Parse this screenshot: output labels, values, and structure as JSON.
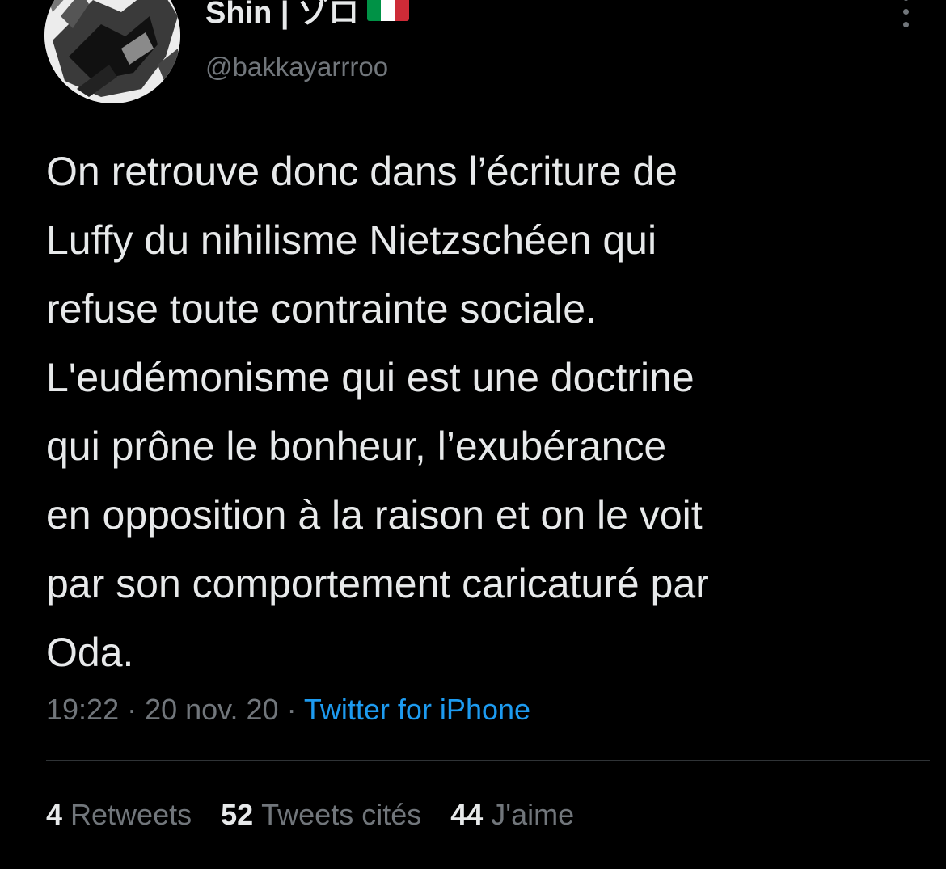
{
  "author": {
    "display_name": "Shin | ゾロ",
    "flag_icon": "italy-flag-icon",
    "handle": "@bakkayarrroo"
  },
  "tweet": {
    "lines": [
      "On retrouve donc dans l’écriture de",
      "Luffy du nihilisme Nietzschéen qui",
      "refuse toute contrainte sociale.",
      "L'eudémonisme qui est une doctrine",
      "qui prône le bonheur, l’exubérance",
      "en opposition à la raison et on le voit",
      "par son comportement caricaturé par",
      "Oda."
    ]
  },
  "meta": {
    "time": "19:22",
    "separator1": " · ",
    "date": "20 nov. 20",
    "separator2": " · ",
    "source": "Twitter for iPhone"
  },
  "stats": {
    "retweets": {
      "count": "4",
      "label": "Retweets"
    },
    "quotes": {
      "count": "52",
      "label": "Tweets cités"
    },
    "likes": {
      "count": "44",
      "label": "J'aime"
    }
  },
  "colors": {
    "background": "#000000",
    "text_primary": "#e7e9ea",
    "text_secondary": "#71767b",
    "link": "#1d9bf0",
    "flag_green": "#009246",
    "flag_white": "#ffffff",
    "flag_red": "#ce2b37"
  }
}
